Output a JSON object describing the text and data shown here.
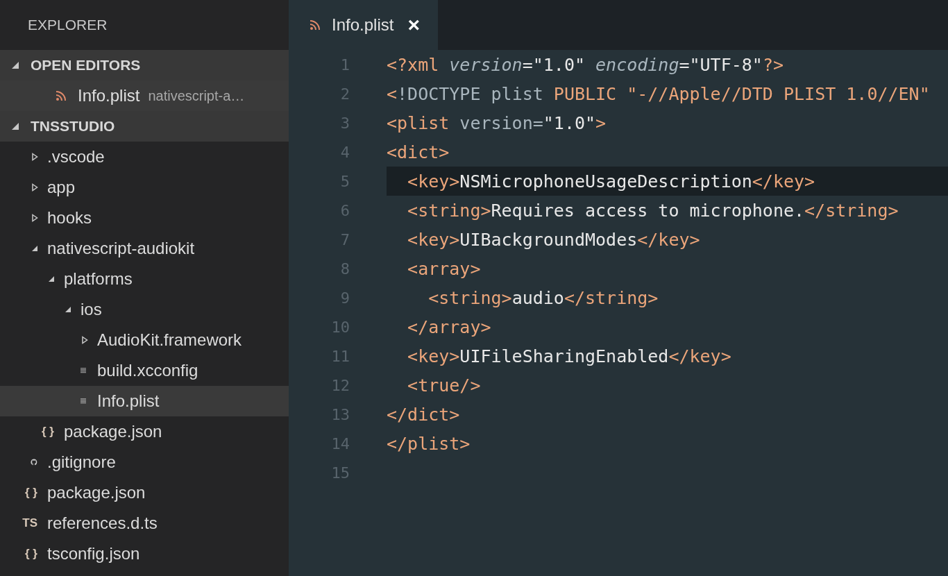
{
  "sidebar": {
    "title": "EXPLORER",
    "sections": [
      {
        "title": "OPEN EDITORS",
        "expanded": true,
        "kind": "editors",
        "items": [
          {
            "label": "Info.plist",
            "description": "nativescript-a…",
            "selected": true
          }
        ]
      },
      {
        "title": "TNSSTUDIO",
        "expanded": true,
        "kind": "tree",
        "items": [
          {
            "label": ".vscode",
            "kind": "folder",
            "expanded": false,
            "selected": false
          },
          {
            "label": "app",
            "kind": "folder",
            "expanded": false,
            "selected": false
          },
          {
            "label": "hooks",
            "kind": "folder",
            "expanded": false,
            "selected": false
          },
          {
            "label": "nativescript-audiokit",
            "kind": "folder",
            "expanded": true,
            "selected": false,
            "children": [
              {
                "label": "platforms",
                "kind": "folder",
                "expanded": true,
                "selected": false,
                "children": [
                  {
                    "label": "ios",
                    "kind": "folder",
                    "expanded": true,
                    "selected": false,
                    "children": [
                      {
                        "label": "AudioKit.framework",
                        "kind": "folder",
                        "expanded": false,
                        "selected": false
                      },
                      {
                        "label": "build.xcconfig",
                        "kind": "doc",
                        "selected": false
                      },
                      {
                        "label": "Info.plist",
                        "kind": "doc",
                        "selected": true
                      }
                    ]
                  }
                ]
              },
              {
                "label": "package.json",
                "kind": "glyph",
                "icon_text": "{ }",
                "selected": false
              }
            ]
          },
          {
            "label": ".gitignore",
            "kind": "git",
            "selected": false
          },
          {
            "label": "package.json",
            "kind": "glyph",
            "icon_text": "{ }",
            "selected": false
          },
          {
            "label": "references.d.ts",
            "kind": "glyph",
            "icon_text": "TS",
            "selected": false
          },
          {
            "label": "tsconfig.json",
            "kind": "glyph",
            "icon_text": "{ }",
            "selected": false
          }
        ]
      }
    ]
  },
  "tabs": [
    {
      "label": "Info.plist",
      "close": "×",
      "selected": true
    }
  ],
  "editor": {
    "lines": [
      {
        "number": "1",
        "highlighted": false,
        "tokens": [
          {
            "kind": "tag",
            "text": "<?xml "
          },
          {
            "kind": "attr",
            "text": "version"
          },
          {
            "kind": "text",
            "text": "=\"1.0\" "
          },
          {
            "kind": "attr",
            "text": "encoding"
          },
          {
            "kind": "text",
            "text": "=\"UTF-8\""
          },
          {
            "kind": "tag",
            "text": "?>"
          }
        ]
      },
      {
        "number": "2",
        "highlighted": false,
        "tokens": [
          {
            "kind": "tag",
            "text": "<"
          },
          {
            "kind": "keyword",
            "text": "!DOCTYPE plist "
          },
          {
            "kind": "tag",
            "text": "PUBLIC \"-//Apple//DTD PLIST 1.0//EN\""
          }
        ]
      },
      {
        "number": "3",
        "highlighted": false,
        "tokens": [
          {
            "kind": "tag",
            "text": "<plist"
          },
          {
            "kind": "keyword",
            "text": " version="
          },
          {
            "kind": "text",
            "text": "\"1.0\""
          },
          {
            "kind": "tag",
            "text": ">"
          }
        ]
      },
      {
        "number": "4",
        "highlighted": false,
        "tokens": [
          {
            "kind": "tag",
            "text": "<dict>"
          }
        ]
      },
      {
        "number": "5",
        "highlighted": true,
        "tokens": [
          {
            "kind": "tag",
            "text": "  <key>"
          },
          {
            "kind": "text",
            "text": "NSMicrophoneUsageDescription"
          },
          {
            "kind": "tag",
            "text": "</key>"
          }
        ]
      },
      {
        "number": "6",
        "highlighted": false,
        "tokens": [
          {
            "kind": "tag",
            "text": "  <string>"
          },
          {
            "kind": "text",
            "text": "Requires access to microphone."
          },
          {
            "kind": "tag",
            "text": "</string>"
          }
        ]
      },
      {
        "number": "7",
        "highlighted": false,
        "tokens": [
          {
            "kind": "tag",
            "text": "  <key>"
          },
          {
            "kind": "text",
            "text": "UIBackgroundModes"
          },
          {
            "kind": "tag",
            "text": "</key>"
          }
        ]
      },
      {
        "number": "8",
        "highlighted": false,
        "tokens": [
          {
            "kind": "tag",
            "text": "  <array>"
          }
        ]
      },
      {
        "number": "9",
        "highlighted": false,
        "tokens": [
          {
            "kind": "tag",
            "text": "    <string>"
          },
          {
            "kind": "text",
            "text": "audio"
          },
          {
            "kind": "tag",
            "text": "</string>"
          }
        ]
      },
      {
        "number": "10",
        "highlighted": false,
        "tokens": [
          {
            "kind": "tag",
            "text": "  </array>"
          }
        ]
      },
      {
        "number": "11",
        "highlighted": false,
        "tokens": [
          {
            "kind": "tag",
            "text": "  <key>"
          },
          {
            "kind": "text",
            "text": "UIFileSharingEnabled"
          },
          {
            "kind": "tag",
            "text": "</key>"
          }
        ]
      },
      {
        "number": "12",
        "highlighted": false,
        "tokens": [
          {
            "kind": "tag",
            "text": "  <true/>"
          }
        ]
      },
      {
        "number": "13",
        "highlighted": false,
        "tokens": [
          {
            "kind": "tag",
            "text": "</dict>"
          }
        ]
      },
      {
        "number": "14",
        "highlighted": false,
        "tokens": [
          {
            "kind": "tag",
            "text": "</plist>"
          }
        ]
      },
      {
        "number": "15",
        "highlighted": false
      }
    ]
  }
}
